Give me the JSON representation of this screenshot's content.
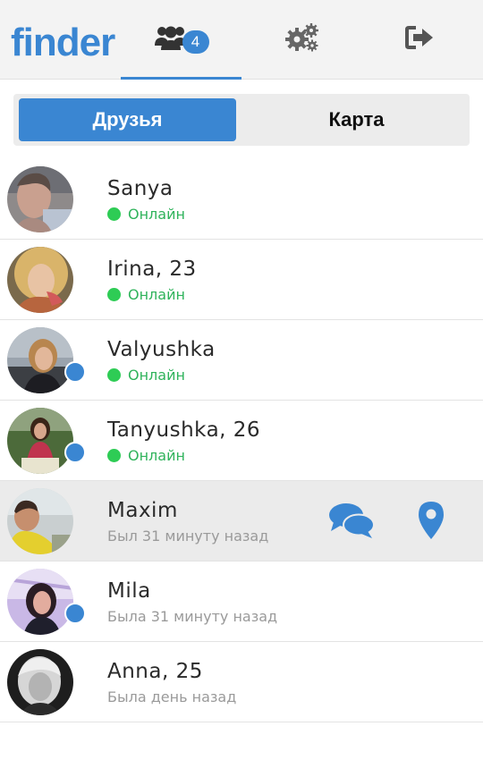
{
  "app": {
    "logo_text": "finder",
    "accent_color": "#3a86d2",
    "online_color": "#2ecc55"
  },
  "nav": {
    "friends_badge": "4",
    "tabs": [
      {
        "icon": "friends-icon",
        "active": true
      },
      {
        "icon": "gears-icon",
        "active": false
      },
      {
        "icon": "logout-icon",
        "active": false
      }
    ]
  },
  "segment": {
    "friends_label": "Друзья",
    "map_label": "Карта",
    "selected": "Друзья"
  },
  "friends": [
    {
      "name": "Sanya",
      "status": "Онлайн",
      "online": true,
      "location_dot": false
    },
    {
      "name": "Irina, 23",
      "status": "Онлайн",
      "online": true,
      "location_dot": false
    },
    {
      "name": "Valyushka",
      "status": "Онлайн",
      "online": true,
      "location_dot": true
    },
    {
      "name": "Tanyushka, 26",
      "status": "Онлайн",
      "online": true,
      "location_dot": true
    },
    {
      "name": "Maxim",
      "status": "Был 31 минуту назад",
      "online": false,
      "location_dot": false,
      "selected": true,
      "actions": [
        "chat-icon",
        "map-pin-icon"
      ]
    },
    {
      "name": "Mila",
      "status": "Была 31 минуту назад",
      "online": false,
      "location_dot": true
    },
    {
      "name": "Anna, 25",
      "status": "Была день назад",
      "online": false,
      "location_dot": false
    }
  ]
}
